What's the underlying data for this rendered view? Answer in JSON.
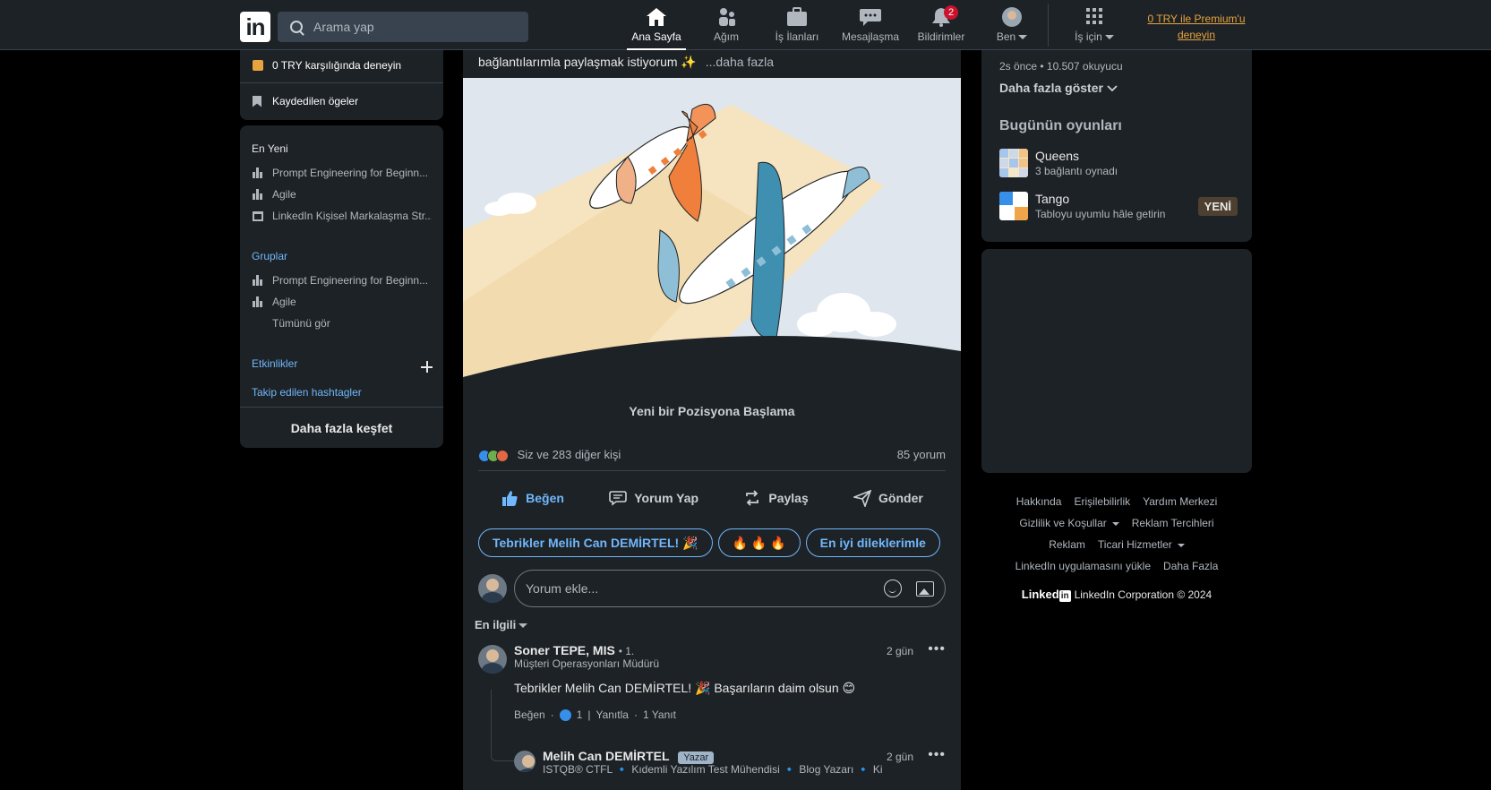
{
  "topnav": {
    "logo": "in",
    "search_placeholder": "Arama yap",
    "items": [
      {
        "label": "Ana Sayfa",
        "icon": "home-icon"
      },
      {
        "label": "Ağım",
        "icon": "network-icon"
      },
      {
        "label": "İş İlanları",
        "icon": "briefcase-icon"
      },
      {
        "label": "Mesajlaşma",
        "icon": "messaging-icon"
      },
      {
        "label": "Bildirimler",
        "icon": "bell-icon",
        "badge": "2"
      },
      {
        "label": "Ben",
        "icon": "avatar"
      },
      {
        "label": "İş için",
        "icon": "grid-icon"
      }
    ],
    "premium_line1": "0 TRY ile Premium'u",
    "premium_line2": "deneyin"
  },
  "left": {
    "premium_trial": "0 TRY karşılığında deneyin",
    "saved": "Kaydedilen ögeler",
    "recent_title": "En Yeni",
    "recent": [
      "Prompt Engineering for Beginn...",
      "Agile",
      "LinkedIn Kişisel Markalaşma Str..."
    ],
    "groups_title": "Gruplar",
    "groups": [
      "Prompt Engineering for Beginn...",
      "Agile"
    ],
    "see_all": "Tümünü gör",
    "events": "Etkinlikler",
    "hashtags": "Takip edilen hashtagler",
    "discover": "Daha fazla keşfet"
  },
  "post": {
    "text": "bağlantılarımla paylaşmak istiyorum ✨",
    "more": "...daha fazla",
    "caption": "Yeni bir Pozisyona Başlama",
    "reactions": "Siz ve 283 diğer kişi",
    "comments_count": "85 yorum",
    "actions": [
      "Beğen",
      "Yorum Yap",
      "Paylaş",
      "Gönder"
    ],
    "chips": [
      "Tebrikler Melih Can DEMİRTEL! 🎉",
      "🔥 🔥 🔥",
      "En iyi dileklerimle"
    ],
    "chip_next": "❯",
    "comment_placeholder": "Yorum ekle...",
    "sort": "En ilgili"
  },
  "comments": [
    {
      "name": "Soner TEPE, MIS",
      "degree": "• 1.",
      "title": "Müşteri Operasyonları Müdürü",
      "time": "2 gün",
      "text": "Tebrikler Melih Can DEMİRTEL! 🎉 Başarıların daim olsun 😊",
      "like": "Beğen",
      "like_count": "1",
      "reply": "Yanıtla",
      "replies": "1 Yanıt"
    },
    {
      "name": "Melih Can DEMİRTEL",
      "badge": "Yazar",
      "title": "ISTQB® CTFL 🔹 Kıdemli Yazılım Test Mühendisi 🔹 Blog Yazarı 🔹 Kişi...",
      "time": "2 gün"
    }
  ],
  "right": {
    "news_meta": "2s önce • 10.507 okuyucu",
    "show_more": "Daha fazla göster",
    "games_title": "Bugünün oyunları",
    "games": [
      {
        "name": "Queens",
        "sub": "3 bağlantı oynadı"
      },
      {
        "name": "Tango",
        "sub": "Tabloyu uyumlu hâle getirin",
        "badge": "YENİ"
      }
    ]
  },
  "footer": {
    "links": [
      "Hakkında",
      "Erişilebilirlik",
      "Yardım Merkezi",
      "Gizlilik ve Koşullar",
      "Reklam Tercihleri",
      "Reklam",
      "Ticari Hizmetler",
      "LinkedIn uygulamasını yükle",
      "Daha Fazla"
    ],
    "brand": "Linked",
    "brand_in": "in",
    "copyright": "LinkedIn Corporation © 2024"
  },
  "colors": {
    "background": "#000000",
    "card": "#1d2226",
    "link_blue": "#71b7fb",
    "premium_gold": "#e7a33e",
    "badge_red": "#cb112d"
  }
}
